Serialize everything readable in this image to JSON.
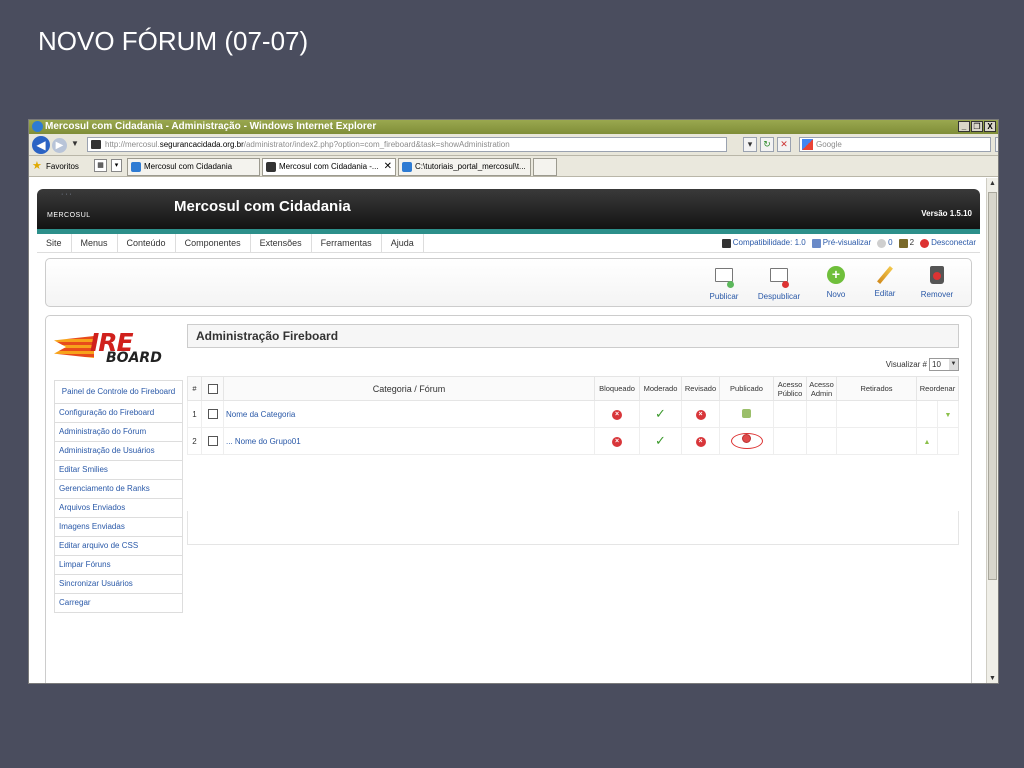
{
  "slide": {
    "title": "NOVO FÓRUM (07-07)"
  },
  "window": {
    "title": "Mercosul com Cidadania - Administração - Windows Internet Explorer",
    "buttons": {
      "minimize": "_",
      "maximize": "❐",
      "close": "X"
    }
  },
  "address": {
    "url_prefix": "http://mercosul.",
    "url_host": "segurancacidada.org.br",
    "url_path": "/administrator/index2.php?option=com_fireboard&task=showAdministration",
    "search_placeholder": "Google"
  },
  "favorites": {
    "label": "Favoritos",
    "tabs": [
      {
        "label": "Mercosul com Cidadania",
        "color": "#2e7bd3"
      },
      {
        "label": "Mercosul com Cidadania -...",
        "color": "#333333"
      },
      {
        "label": "C:\\tutoriais_portal_mercosul\\t...",
        "color": "#2e7bd3"
      }
    ]
  },
  "admin": {
    "logo": "MERCOSUL",
    "site_name": "Mercosul com Cidadania",
    "version": "Versão 1.5.10",
    "menu": [
      "Site",
      "Menus",
      "Conteúdo",
      "Componentes",
      "Extensões",
      "Ferramentas",
      "Ajuda"
    ],
    "status": {
      "compat": "Compatibilidade: 1.0",
      "preview": "Pré-visualizar",
      "messages": "0",
      "users": "2",
      "logout": "Desconectar"
    }
  },
  "toolbar": {
    "publish": "Publicar",
    "unpublish": "Despublicar",
    "new": "Novo",
    "edit": "Editar",
    "remove": "Remover"
  },
  "fireboard": {
    "logo_top": "IRE",
    "logo_bottom": "BOARD",
    "title": "Administração Fireboard",
    "visualizar_label": "Visualizar #",
    "visualizar_value": "10",
    "sidebar": [
      "Painel de Controle do Fireboard",
      "Configuração do Fireboard",
      "Administração do Fórum",
      "Administração de Usuários",
      "Editar Smilies",
      "Gerenciamento de Ranks",
      "Arquivos Enviados",
      "Imagens Enviadas",
      "Editar arquivo de CSS",
      "Limpar Fóruns",
      "Sincronizar Usuários",
      "Carregar"
    ],
    "columns": {
      "num": "#",
      "category": "Categoria / Fórum",
      "blocked": "Bloqueado",
      "moderated": "Moderado",
      "reviewed": "Revisado",
      "published": "Publicado",
      "public_access": "Acesso Público",
      "admin_access": "Acesso Admin",
      "retired": "Retirados",
      "reorder": "Reordenar"
    },
    "rows": [
      {
        "num": "1",
        "name": "Nome da Categoria"
      },
      {
        "num": "2",
        "name": "... Nome do Grupo01"
      }
    ]
  }
}
